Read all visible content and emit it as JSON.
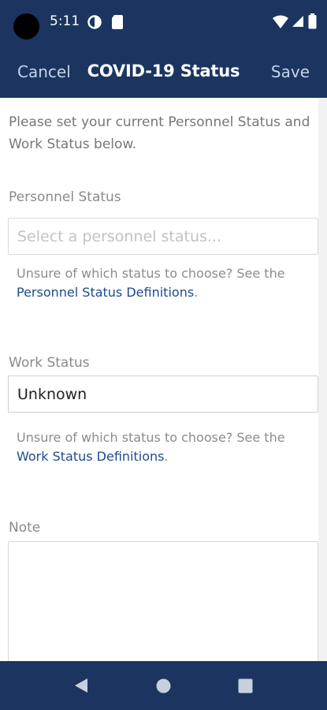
{
  "status_bar": {
    "time": "5:11",
    "icons": [
      "camera-cutout",
      "data-saver-icon",
      "sim-card-icon",
      "wifi-icon",
      "signal-icon",
      "battery-icon"
    ]
  },
  "nav": {
    "cancel_label": "Cancel",
    "title": "COVID-19 Status",
    "save_label": "Save"
  },
  "form": {
    "intro": "Please set your current Personnel Status and Work Status below.",
    "personnel": {
      "label": "Personnel Status",
      "placeholder": "Select a personnel status...",
      "help_prefix": "Unsure of which status to choose? See the",
      "help_link": "Personnel Status Definitions",
      "help_suffix": "."
    },
    "work": {
      "label": "Work Status",
      "value": "Unknown",
      "help_prefix": "Unsure of which status to choose? See the",
      "help_link": "Work Status Definitions",
      "help_suffix": "."
    },
    "note": {
      "label": "Note",
      "value": ""
    }
  },
  "system_nav": {
    "buttons": [
      "back-icon",
      "home-icon",
      "recents-icon"
    ]
  },
  "colors": {
    "header": "#1b3560",
    "link": "#1f4a8a"
  }
}
